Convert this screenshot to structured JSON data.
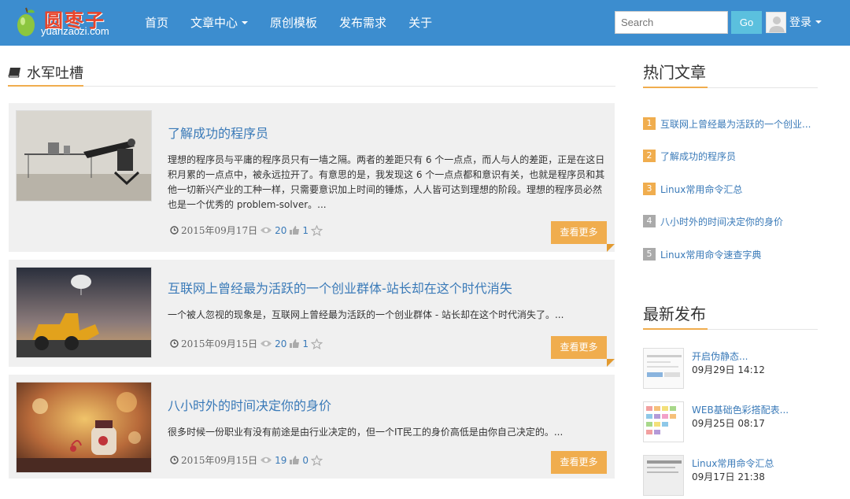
{
  "site": {
    "logo_text": "圆枣子",
    "logo_sub": "yuanzaozi.com"
  },
  "nav": {
    "items": [
      {
        "label": "首页",
        "dropdown": false
      },
      {
        "label": "文章中心",
        "dropdown": true
      },
      {
        "label": "原创模板",
        "dropdown": false
      },
      {
        "label": "发布需求",
        "dropdown": false
      },
      {
        "label": "关于",
        "dropdown": false
      }
    ],
    "search_placeholder": "Search",
    "search_button": "Go",
    "login_label": "登录"
  },
  "section": {
    "title": "水军吐槽",
    "icon": "book-icon"
  },
  "articles": [
    {
      "title": "了解成功的程序员",
      "excerpt": "理想的程序员与平庸的程序员只有一墙之隔。两者的差距只有 6 个一点点，而人与人的差距，正是在这日积月累的一点点中，被永远拉开了。有意思的是，我发现这 6 个一点点都和意识有关，也就是程序员和其他一切新兴产业的工种一样，只需要意识加上时间的锤炼，人人皆可达到理想的阶段。理想的程序员必然也是一个优秀的 problem-solver。...",
      "date": "2015年09月17日",
      "views": "20",
      "likes": "1",
      "more": "查看更多"
    },
    {
      "title": "互联网上曾经最为活跃的一个创业群体-站长却在这个时代消失",
      "excerpt": "一个被人忽视的现象是，互联网上曾经最为活跃的一个创业群体 - 站长却在这个时代消失了。...",
      "date": "2015年09月15日",
      "views": "20",
      "likes": "1",
      "more": "查看更多"
    },
    {
      "title": "八小时外的时间决定你的身价",
      "excerpt": "很多时候一份职业有没有前途是由行业决定的，但一个IT民工的身价高低是由你自己决定的。...",
      "date": "2015年09月15日",
      "views": "19",
      "likes": "0",
      "more": "查看更多"
    }
  ],
  "sidebar": {
    "hot_title": "热门文章",
    "hot": [
      {
        "rank": "1",
        "title": "互联网上曾经最为活跃的一个创业...",
        "color": "#f0ad4e"
      },
      {
        "rank": "2",
        "title": "了解成功的程序员",
        "color": "#f0ad4e"
      },
      {
        "rank": "3",
        "title": "Linux常用命令汇总",
        "color": "#f0ad4e"
      },
      {
        "rank": "4",
        "title": "八小时外的时间决定你的身价",
        "color": "#aaaaaa"
      },
      {
        "rank": "5",
        "title": "Linux常用命令速查字典",
        "color": "#aaaaaa"
      }
    ],
    "new_title": "最新发布",
    "new": [
      {
        "title": "开启伪静态...",
        "date": "09月29日 14:12"
      },
      {
        "title": "WEB基础色彩搭配表...",
        "date": "09月25日 08:17"
      },
      {
        "title": "Linux常用命令汇总",
        "date": "09月17日 21:38"
      }
    ]
  },
  "colors": {
    "nav_bg": "#3c8dcf",
    "accent": "#f0ad4e",
    "link": "#3a7ab8",
    "logo_red": "#e8452b"
  }
}
